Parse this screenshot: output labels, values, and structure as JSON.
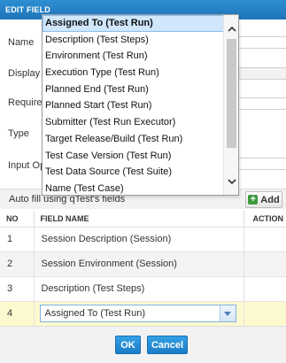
{
  "dialog": {
    "title": "EDIT FIELD"
  },
  "form": {
    "labels": {
      "name": "Name",
      "display": "Display L",
      "required": "Required",
      "type": "Type",
      "input_options": "Input Opt"
    }
  },
  "auto_fill": {
    "label": "Auto fill using qTest's fields",
    "add_label": "Add"
  },
  "table": {
    "headers": {
      "no": "NO",
      "field_name": "FIELD NAME",
      "action": "ACTION"
    },
    "rows": [
      {
        "no": "1",
        "field": "Session Description (Session)"
      },
      {
        "no": "2",
        "field": "Session Environment (Session)"
      },
      {
        "no": "3",
        "field": "Description (Test Steps)"
      },
      {
        "no": "4",
        "field": "Assigned To (Test Run)"
      }
    ]
  },
  "dropdown": {
    "selected": "Assigned To (Test Run)",
    "items": [
      "Assigned To (Test Run)",
      "Description (Test Steps)",
      "Environment (Test Run)",
      "Execution Type (Test Run)",
      "Planned End (Test Run)",
      "Planned Start (Test Run)",
      "Submitter (Test Run Executor)",
      "Target Release/Build (Test Run)",
      "Test Case Version (Test Run)",
      "Test Data Source (Test Suite)",
      "Name (Test Case)"
    ]
  },
  "footer": {
    "ok_label": "OK",
    "cancel_label": "Cancel"
  },
  "colors": {
    "title_bar": "#1f74b8",
    "button_primary": "#1a7cc6",
    "selected_item": "#cfe6fb",
    "active_row": "#fdf9cf",
    "add_icon": "#3d9a3d"
  }
}
